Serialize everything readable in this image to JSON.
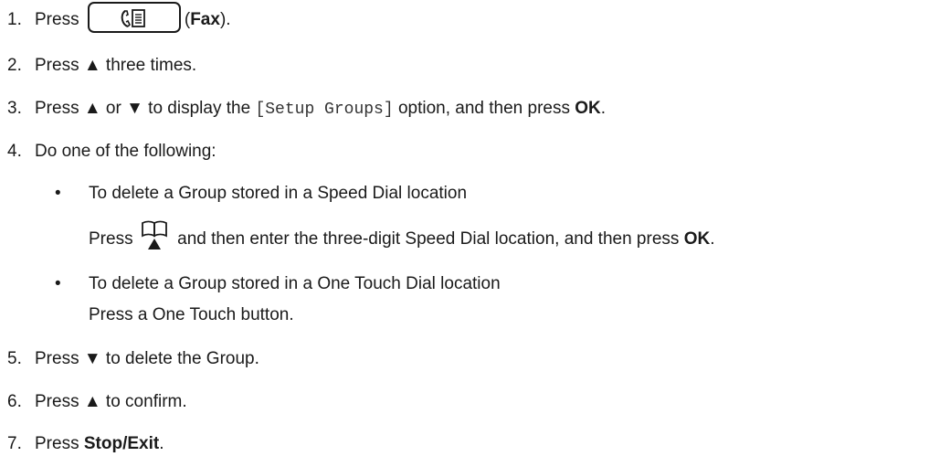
{
  "steps": [
    {
      "num": "1.",
      "press": "Press",
      "paren_open": "(",
      "fax_label": "Fax",
      "paren_close": ").",
      "icon": "fax-button-icon"
    },
    {
      "num": "2.",
      "text": "Press ▲ three times."
    },
    {
      "num": "3.",
      "pre": "Press ▲ or ▼ to display the ",
      "code": "[Setup Groups]",
      "mid": " option, and then press ",
      "bold": "OK",
      "post": "."
    },
    {
      "num": "4.",
      "text": "Do one of the following:"
    },
    {
      "num": "5.",
      "text": "Press ▼ to delete the Group."
    },
    {
      "num": "6.",
      "text": "Press ▲ to confirm."
    },
    {
      "num": "7.",
      "press": "Press ",
      "bold": "Stop/Exit",
      "post": "."
    }
  ],
  "options": [
    {
      "bullet": "•",
      "heading": "To delete a Group stored in a Speed Dial location",
      "pre": "Press ",
      "icon": "address-book-icon",
      "mid": " and then enter the three-digit Speed Dial location, and then press ",
      "bold": "OK",
      "post": "."
    },
    {
      "bullet": "•",
      "heading": "To delete a Group stored in a One Touch Dial location",
      "text": "Press a One Touch button."
    }
  ]
}
